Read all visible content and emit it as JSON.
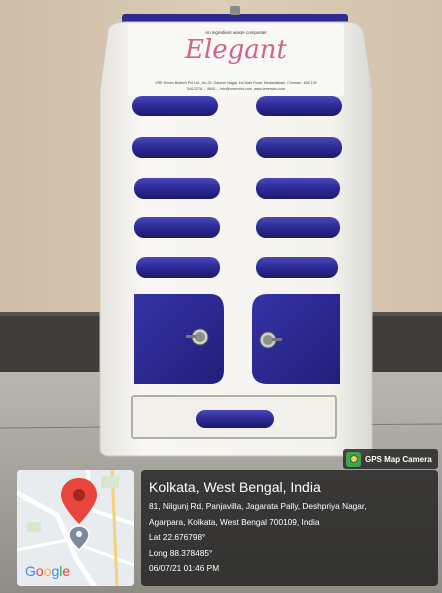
{
  "photo": {
    "description_icons": {
      "map_pin": "map-pin-icon",
      "camera": "gps-camera-icon"
    },
    "colors": {
      "wall": "#d8c9b2",
      "floor": "#a8a59f",
      "cabinet_body": "#f4f3ee",
      "handle_blue": "#2c2a8c",
      "door_blue": "#2a2890"
    },
    "cabinet_label": {
      "brand_logo_text": "Elegant",
      "brand_tagline": "An ingredient waste composter",
      "maker_line": "VRE Enviro Biotech Pvt Ltd., No 25, Ganesh Nagar, 1st Main Road, Medavakkam, Chennai - 600 100",
      "contact_line": "044-2278..., 9840..., info@vreenviro.com, www.vreenviro.com"
    }
  },
  "gps_overlay": {
    "app_label": "GPS Map Camera",
    "place_title": "Kolkata, West Bengal, India",
    "address_line1": "81, Nilgunj Rd, Panjavilla, Jagarata Pally, Deshpriya Nagar,",
    "address_line2": "Agarpara, Kolkata, West Bengal 700109, India",
    "latitude": "Lat 22.676798°",
    "longitude": "Long 88.378485°",
    "datetime": "06/07/21 01:46 PM",
    "map_logo": "Google",
    "map_pin_color": "#e8453c"
  }
}
